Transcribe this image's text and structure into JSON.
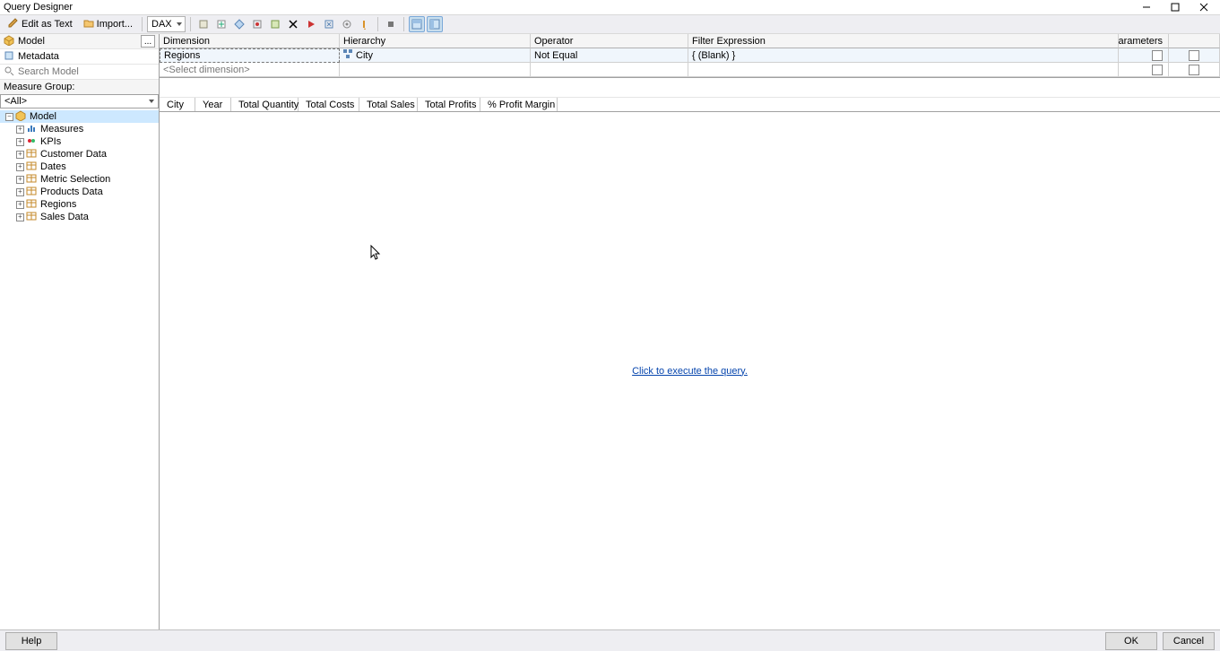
{
  "window": {
    "title": "Query Designer"
  },
  "toolbar": {
    "edit_as_text": "Edit as Text",
    "import": "Import...",
    "lang": "DAX"
  },
  "sidebar": {
    "model_label": "Model",
    "metadata_label": "Metadata",
    "search_placeholder": "Search Model",
    "measure_group_label": "Measure Group:",
    "measure_group_value": "<All>",
    "tree_root": "Model",
    "tree_items": [
      "Measures",
      "KPIs",
      "Customer Data",
      "Dates",
      "Metric Selection",
      "Products Data",
      "Regions",
      "Sales Data"
    ]
  },
  "filter": {
    "headers": {
      "dimension": "Dimension",
      "hierarchy": "Hierarchy",
      "operator": "Operator",
      "filter_expression": "Filter Expression",
      "parameters": "Parameters"
    },
    "rows": [
      {
        "dimension": "Regions",
        "hierarchy": "City",
        "operator": "Not Equal",
        "filter_expression": "{ (Blank) }"
      }
    ],
    "placeholder": "<Select dimension>"
  },
  "result": {
    "columns": [
      "City",
      "Year",
      "Total Quantity",
      "Total Costs",
      "Total Sales",
      "Total Profits",
      "% Profit Margin"
    ],
    "execute_link": "Click to execute the query."
  },
  "footer": {
    "help": "Help",
    "ok": "OK",
    "cancel": "Cancel"
  }
}
